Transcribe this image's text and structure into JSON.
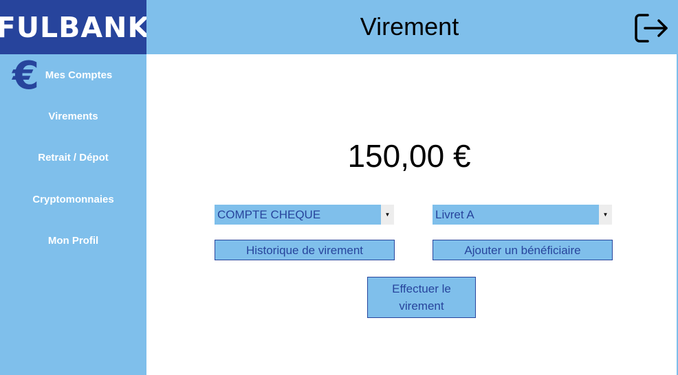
{
  "brand": {
    "logo_text": "FULBANK"
  },
  "header": {
    "title": "Virement",
    "logout_icon": "logout-icon"
  },
  "sidebar": {
    "items": [
      {
        "label": "Mes Comptes",
        "icon": "euro-icon"
      },
      {
        "label": "Virements"
      },
      {
        "label": "Retrait / Dépot"
      },
      {
        "label": "Cryptomonnaies"
      },
      {
        "label": "Mon Profil"
      }
    ]
  },
  "main": {
    "amount": "150,00 €",
    "from_account": {
      "selected": "COMPTE CHEQUE"
    },
    "to_account": {
      "selected": "Livret A"
    },
    "history_button": "Historique de virement",
    "add_beneficiary_button": "Ajouter un bénéficiaire",
    "submit_button": "Effectuer le virement"
  },
  "colors": {
    "brand_dark": "#27449c",
    "accent_light": "#7fbfeb"
  }
}
